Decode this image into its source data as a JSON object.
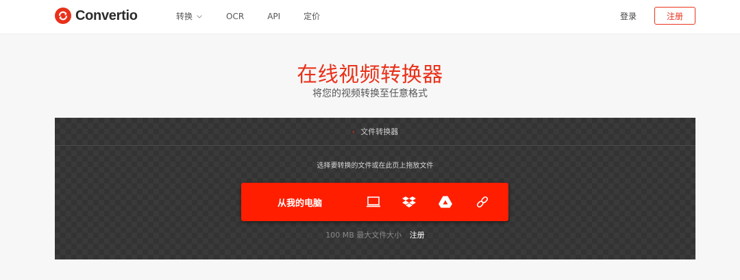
{
  "header": {
    "brand": "Convertio",
    "nav": [
      {
        "label": "转换",
        "has_dropdown": true
      },
      {
        "label": "OCR",
        "has_dropdown": false
      },
      {
        "label": "API",
        "has_dropdown": false
      },
      {
        "label": "定价",
        "has_dropdown": false
      }
    ],
    "login_label": "登录",
    "register_label": "注册"
  },
  "hero": {
    "title": "在线视频转换器",
    "subtitle": "将您的视频转换至任意格式"
  },
  "converter": {
    "breadcrumb": "文件转换器",
    "hint": "选择要转换的文件或在此页上拖放文件",
    "upload_label": "从我的电脑",
    "sources": [
      "computer-icon",
      "dropbox-icon",
      "google-drive-icon",
      "url-link-icon"
    ],
    "limit_text": "100 MB 最大文件大小",
    "limit_register": "注册"
  },
  "colors": {
    "accent": "#e9311a",
    "upload_bg": "#ff1e00",
    "panel_bg": "#333333"
  }
}
